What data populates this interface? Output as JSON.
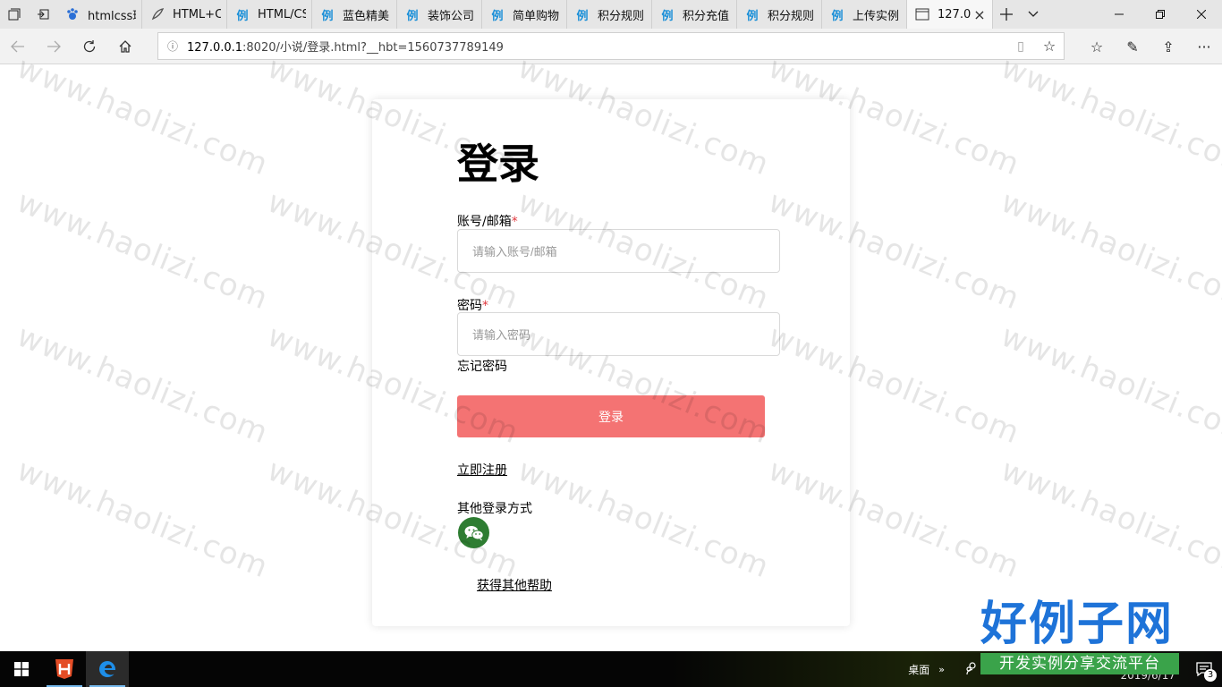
{
  "browser": {
    "tabs": [
      {
        "label": "htmlcss环",
        "icon": "paw-icon"
      },
      {
        "label": "HTML+CS",
        "icon": "feather-icon"
      },
      {
        "label": "HTML/CS",
        "icon": "li-icon"
      },
      {
        "label": "蓝色精美",
        "icon": "li-icon"
      },
      {
        "label": "装饰公司",
        "icon": "li-icon"
      },
      {
        "label": "简单购物",
        "icon": "li-icon"
      },
      {
        "label": "积分规则",
        "icon": "li-icon"
      },
      {
        "label": "积分充值",
        "icon": "li-icon"
      },
      {
        "label": "积分规则",
        "icon": "li-icon"
      },
      {
        "label": "上传实例",
        "icon": "li-icon"
      },
      {
        "label": "127.0",
        "icon": "page-icon",
        "active": true
      }
    ],
    "tab_icon_glyph": "例",
    "url_host": "127.0.0.1",
    "url_rest": ":8020/小说/登录.html?__hbt=1560737789149"
  },
  "login": {
    "title": "登录",
    "account_label": "账号/邮箱",
    "required_mark": "*",
    "account_placeholder": "请输入账号/邮箱",
    "password_label": "密码",
    "password_placeholder": "请输入密码",
    "forgot_label": "忘记密码",
    "submit_label": "登录",
    "register_link": "立即注册",
    "other_methods_label": "其他登录方式",
    "help_link": "获得其他帮助"
  },
  "watermark": "www.haolizi.com",
  "logo": {
    "title": "好例子网",
    "subtitle": "开发实例分享交流平台"
  },
  "taskbar": {
    "desktop_label": "桌面",
    "clock_fragment": "2019/6/17",
    "notification_count": "3"
  },
  "colors": {
    "accent_button": "#f47373",
    "required": "#e0383e",
    "wechat": "#2e7d32",
    "logo_blue": "#1e73d8",
    "logo_green": "#3aa34a"
  }
}
